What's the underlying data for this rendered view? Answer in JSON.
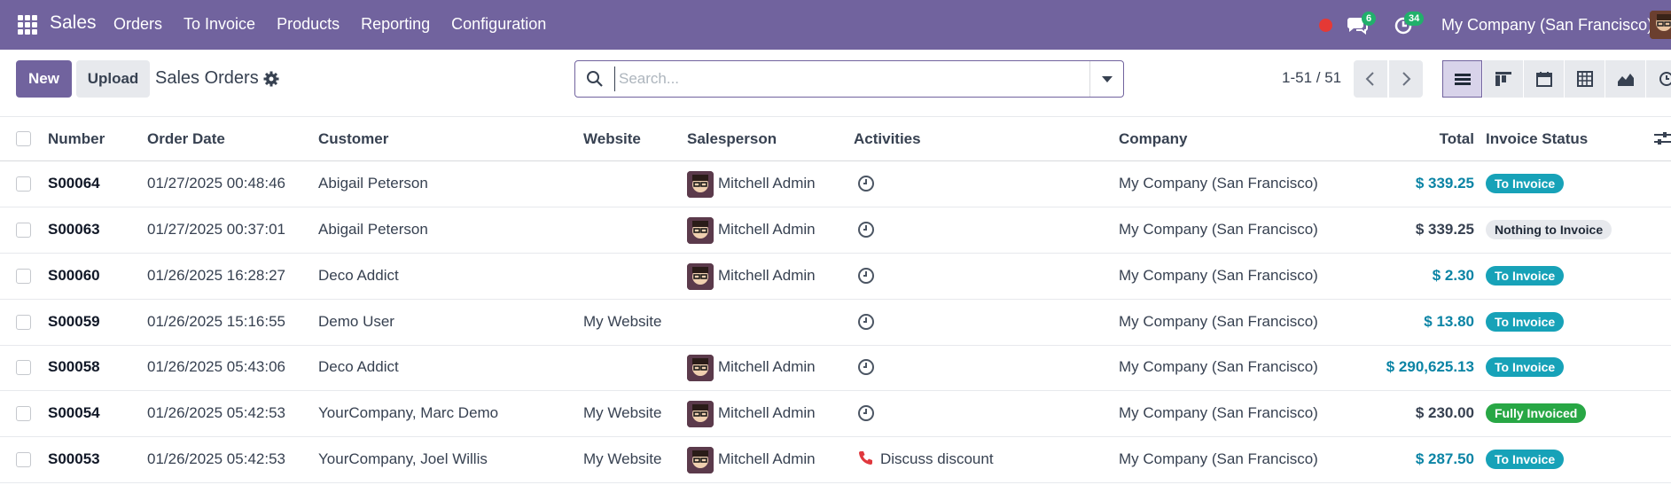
{
  "navbar": {
    "app_name": "Sales",
    "menu": [
      "Orders",
      "To Invoice",
      "Products",
      "Reporting",
      "Configuration"
    ],
    "messages_count": "6",
    "activities_count": "34",
    "company": "My Company (San Francisco)"
  },
  "control": {
    "new_label": "New",
    "upload_label": "Upload",
    "title": "Sales Orders",
    "search_placeholder": "Search...",
    "pager": "1-51 / 51"
  },
  "table": {
    "headers": {
      "number": "Number",
      "order_date": "Order Date",
      "customer": "Customer",
      "website": "Website",
      "salesperson": "Salesperson",
      "activities": "Activities",
      "company": "Company",
      "total": "Total",
      "invoice_status": "Invoice Status"
    },
    "rows": [
      {
        "number": "S00064",
        "date": "01/27/2025 00:48:46",
        "customer": "Abigail Peterson",
        "website": "",
        "salesperson": "Mitchell Admin",
        "activity": "",
        "company": "My Company (San Francisco)",
        "total": "$ 339.25",
        "status": "To Invoice"
      },
      {
        "number": "S00063",
        "date": "01/27/2025 00:37:01",
        "customer": "Abigail Peterson",
        "website": "",
        "salesperson": "Mitchell Admin",
        "activity": "",
        "company": "My Company (San Francisco)",
        "total": "$ 339.25",
        "status": "Nothing to Invoice"
      },
      {
        "number": "S00060",
        "date": "01/26/2025 16:28:27",
        "customer": "Deco Addict",
        "website": "",
        "salesperson": "Mitchell Admin",
        "activity": "",
        "company": "My Company (San Francisco)",
        "total": "$ 2.30",
        "status": "To Invoice"
      },
      {
        "number": "S00059",
        "date": "01/26/2025 15:16:55",
        "customer": "Demo User",
        "website": "My Website",
        "salesperson": "",
        "activity": "",
        "company": "My Company (San Francisco)",
        "total": "$ 13.80",
        "status": "To Invoice"
      },
      {
        "number": "S00058",
        "date": "01/26/2025 05:43:06",
        "customer": "Deco Addict",
        "website": "",
        "salesperson": "Mitchell Admin",
        "activity": "",
        "company": "My Company (San Francisco)",
        "total": "$ 290,625.13",
        "status": "To Invoice"
      },
      {
        "number": "S00054",
        "date": "01/26/2025 05:42:53",
        "customer": "YourCompany, Marc Demo",
        "website": "My Website",
        "salesperson": "Mitchell Admin",
        "activity": "",
        "company": "My Company (San Francisco)",
        "total": "$ 230.00",
        "status": "Fully Invoiced"
      },
      {
        "number": "S00053",
        "date": "01/26/2025 05:42:53",
        "customer": "YourCompany, Joel Willis",
        "website": "My Website",
        "salesperson": "Mitchell Admin",
        "activity": "Discuss discount",
        "company": "My Company (San Francisco)",
        "total": "$ 287.50",
        "status": "To Invoice"
      }
    ]
  },
  "colors": {
    "brand": "#71639e",
    "info": "#17a2b8",
    "success": "#28a745",
    "link": "#0b84a5"
  }
}
